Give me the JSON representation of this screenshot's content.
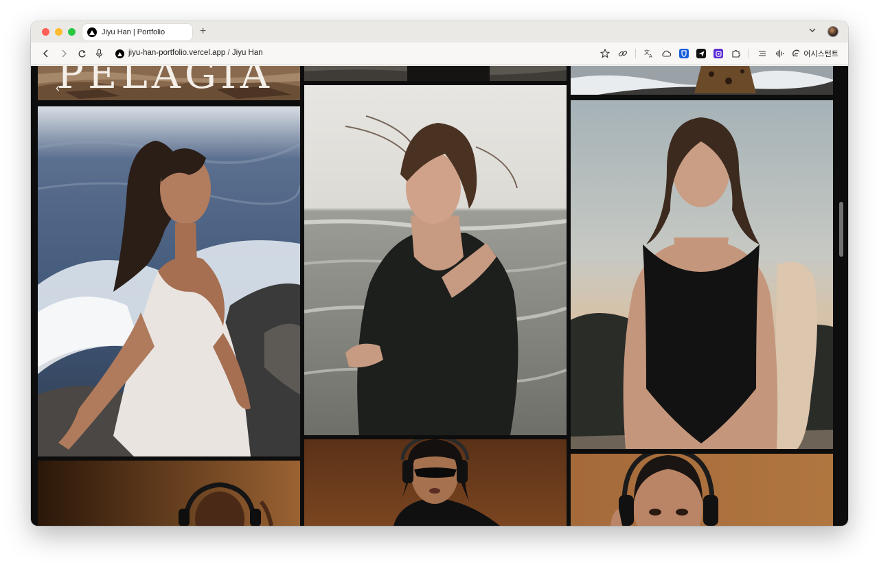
{
  "browser": {
    "tab_title": "Jiyu Han | Portfolio",
    "new_tab_label": "+",
    "url_domain": "jiyu-han-portfolio.vercel.app",
    "url_separator": "/",
    "url_path": "Jiyu Han",
    "assistant_label": "어시스턴트",
    "icons": [
      "back-icon",
      "forward-icon",
      "reload-icon",
      "microphone-icon",
      "star-icon",
      "link-icon",
      "translate-icon",
      "cloud-icon",
      "bitwarden-icon",
      "send-icon",
      "extension-purple-icon",
      "puzzle-icon",
      "reading-list-icon",
      "audio-icon"
    ]
  },
  "page": {
    "hero_title": "PELAGIA",
    "back_arrow": "‹",
    "gallery": [
      {
        "id": "top-left",
        "subject": "rocks with hero title"
      },
      {
        "id": "top-middle",
        "subject": "rocks"
      },
      {
        "id": "top-right",
        "subject": "sea and leopard coat"
      },
      {
        "id": "woman-white-dress",
        "subject": "woman in white dress on rocks by waves"
      },
      {
        "id": "woman-black-top",
        "subject": "woman in black top by the sea"
      },
      {
        "id": "woman-swimsuit",
        "subject": "woman in black swimsuit"
      },
      {
        "id": "headphones-left",
        "subject": "model with headphones"
      },
      {
        "id": "headphones-middle",
        "subject": "model with sunglasses and headphones"
      },
      {
        "id": "headphones-right",
        "subject": "model with headphones"
      }
    ]
  },
  "colors": {
    "background": "#0d0d0d",
    "accent_red": "#fe5f57",
    "accent_yellow": "#febc2e",
    "accent_green": "#28c840"
  }
}
